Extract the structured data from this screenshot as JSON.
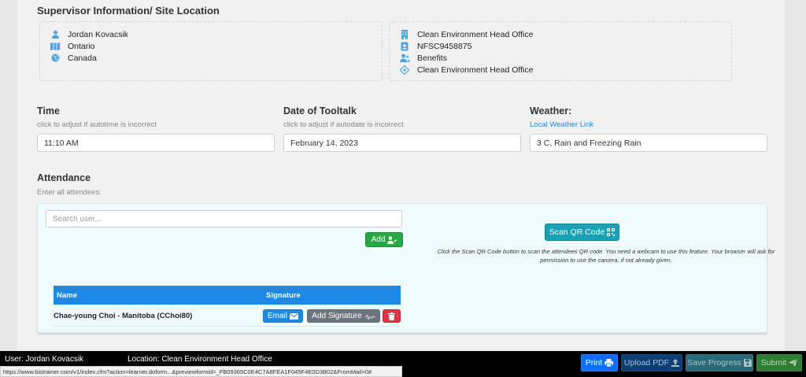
{
  "supervisor": {
    "title": "Supervisor Information/ Site Location",
    "left": [
      {
        "icon": "user-icon",
        "text": "Jordan Kovacsik"
      },
      {
        "icon": "map-icon",
        "text": "Ontario"
      },
      {
        "icon": "globe-icon",
        "text": "Canada"
      }
    ],
    "right": [
      {
        "icon": "building-icon",
        "text": "Clean Environment Head Office"
      },
      {
        "icon": "id-badge-icon",
        "text": "NFSC9458875"
      },
      {
        "icon": "users-icon",
        "text": "Benefits"
      },
      {
        "icon": "location-crosshair-icon",
        "text": "Clean Environment Head Office"
      }
    ]
  },
  "time": {
    "label": "Time",
    "hint": "click to adjust if autotime is incorrect",
    "value": "11:10 AM"
  },
  "date": {
    "label": "Date of Tooltalk",
    "hint": "click to adjust if autodate is incorrect",
    "value": "February 14, 2023"
  },
  "weather": {
    "label": "Weather:",
    "link": "Local Weather Link",
    "value": "3 C, Rain and Freezing Rain"
  },
  "attendance": {
    "title": "Attendance",
    "hint": "Enter all attendees.",
    "search_placeholder": "Search user...",
    "add_label": "Add",
    "qr_label": "Scan QR Code",
    "qr_note": "Click the Scan QR Code button to scan the attendees QR code. You need a webcam to use this feature. Your browser will ask for permission to use the camera, if not already given.",
    "columns": [
      "Name",
      "Signature"
    ],
    "rows": [
      {
        "name": "Chae-young Choi - Manitoba (CChoi80)",
        "email_label": "Email",
        "signature_label": "Add Signature"
      }
    ]
  },
  "footer": {
    "user": "User: Jordan Kovacsik",
    "location": "Location: Clean Environment Head Office",
    "url": "https://www.bistrainer.com/v1/index.cfm?action=learner.doform...&previewformid=_FB09365C0E4C7A8FEA1F045F4E0D3B02&FromMail=0#",
    "print_label": "Print",
    "upload_label": "Upload PDF",
    "save_label": "Save Progress",
    "submit_label": "Submit"
  },
  "colors": {
    "primary": "#1e88e5",
    "success": "#28a745",
    "info": "#17a2b8",
    "danger": "#dc3545",
    "icon": "#4fa3e0"
  }
}
